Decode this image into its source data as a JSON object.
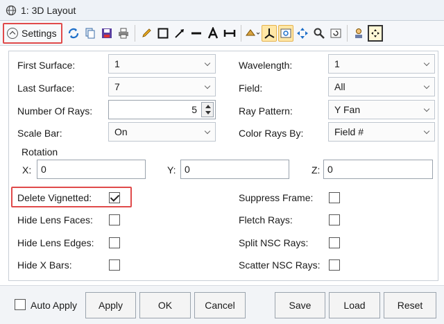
{
  "window": {
    "title": "1: 3D Layout"
  },
  "toolbar": {
    "settings_label": "Settings"
  },
  "fields": {
    "first_surface": {
      "label": "First Surface:",
      "value": "1"
    },
    "last_surface": {
      "label": "Last Surface:",
      "value": "7"
    },
    "number_of_rays": {
      "label": "Number Of Rays:",
      "value": "5"
    },
    "scale_bar": {
      "label": "Scale Bar:",
      "value": "On"
    },
    "wavelength": {
      "label": "Wavelength:",
      "value": "1"
    },
    "field": {
      "label": "Field:",
      "value": "All"
    },
    "ray_pattern": {
      "label": "Ray Pattern:",
      "value": "Y Fan"
    },
    "color_rays_by": {
      "label": "Color Rays By:",
      "value": "Field #"
    }
  },
  "rotation": {
    "label": "Rotation",
    "x": {
      "label": "X:",
      "value": "0"
    },
    "y": {
      "label": "Y:",
      "value": "0"
    },
    "z": {
      "label": "Z:",
      "value": "0"
    }
  },
  "checkboxes": {
    "delete_vignetted": {
      "label": "Delete Vignetted:",
      "checked": true
    },
    "hide_lens_faces": {
      "label": "Hide Lens Faces:",
      "checked": false
    },
    "hide_lens_edges": {
      "label": "Hide Lens Edges:",
      "checked": false
    },
    "hide_x_bars": {
      "label": "Hide X Bars:",
      "checked": false
    },
    "suppress_frame": {
      "label": "Suppress Frame:",
      "checked": false
    },
    "fletch_rays": {
      "label": "Fletch Rays:",
      "checked": false
    },
    "split_nsc_rays": {
      "label": "Split NSC Rays:",
      "checked": false
    },
    "scatter_nsc_rays": {
      "label": "Scatter NSC Rays:",
      "checked": false
    }
  },
  "bottom": {
    "auto_apply": {
      "label": "Auto Apply",
      "checked": false
    },
    "apply": "Apply",
    "ok": "OK",
    "cancel": "Cancel",
    "save": "Save",
    "load": "Load",
    "reset": "Reset"
  },
  "colors": {
    "highlight": "#e04a4a",
    "accent": "#1e6fc9",
    "active_tool": "#ffe7a6"
  }
}
